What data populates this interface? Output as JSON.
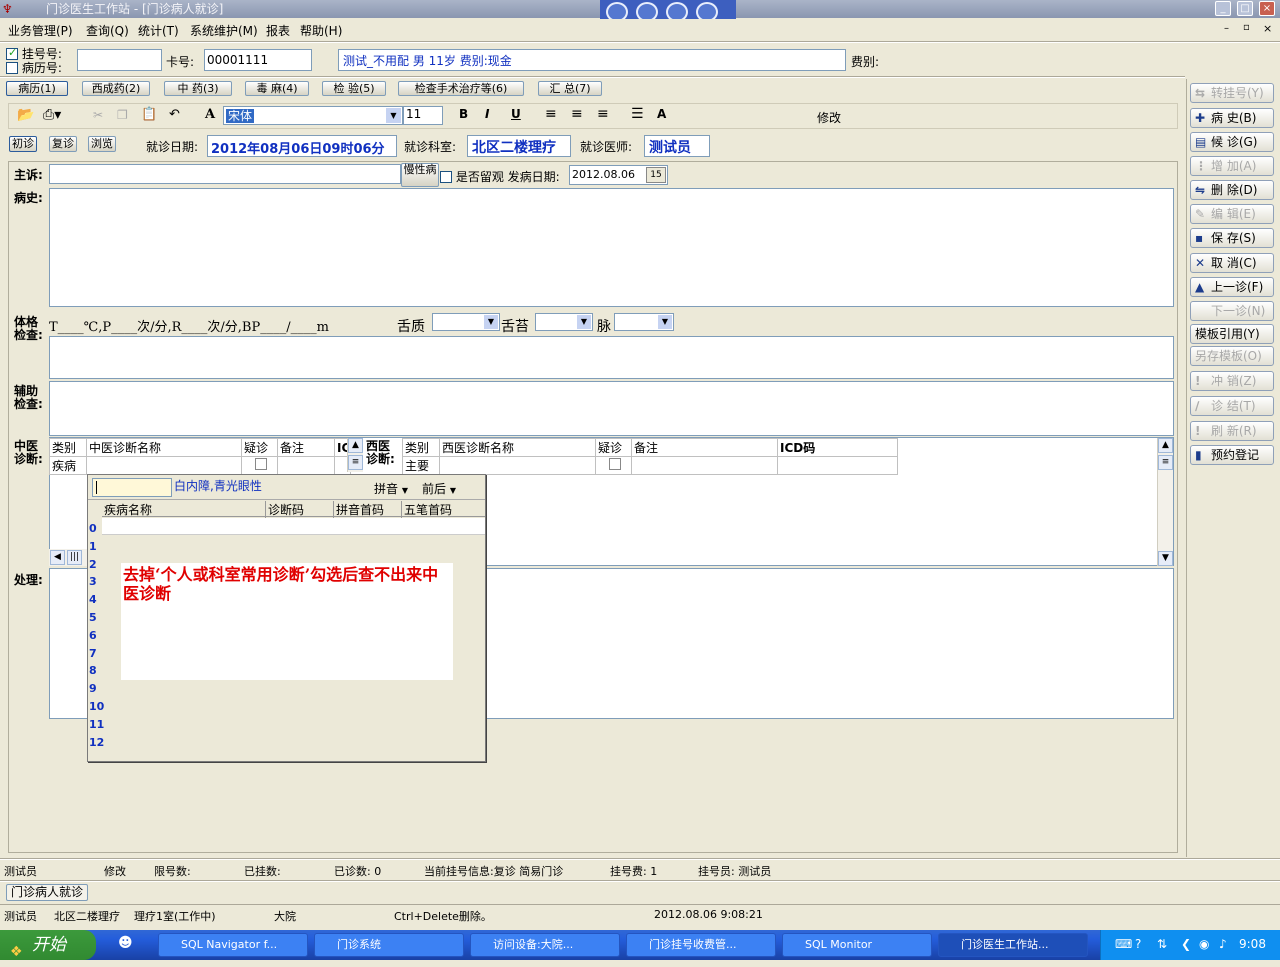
{
  "window": {
    "title": "门诊医生工作站 - [门诊病人就诊]"
  },
  "menu": [
    "业务管理(P)",
    "查询(Q)",
    "统计(T)",
    "系统维护(M)",
    "报表",
    "帮助(H)"
  ],
  "patient": {
    "reg_label": "挂号号:",
    "record_label": "病历号:",
    "card_label": "卡号:",
    "card_value": "00001111",
    "info": "测试_不用配 男 11岁 费别:现金",
    "fee_label": "费别:"
  },
  "tabs": [
    "病历(1)",
    "西成药(2)",
    "中 药(3)",
    "毒 麻(4)",
    "检 验(5)",
    "检查手术治疗等(6)",
    "汇 总(7)"
  ],
  "toolbar": {
    "font": "宋体",
    "size": "11",
    "bold": "B",
    "italic": "I",
    "underline": "U",
    "edit_label": "修改"
  },
  "visit": {
    "first": "初诊",
    "repeat": "复诊",
    "browse": "浏览",
    "date_label": "就诊日期:",
    "date": "2012年08月06日09时06分",
    "dept_label": "就诊科室:",
    "dept": "北区二楼理疗",
    "doctor_label": "就诊医师:",
    "doctor": "测试员"
  },
  "form": {
    "complaint_label": "主诉:",
    "chronic_label": "慢性病",
    "observe_label": "是否留观",
    "onset_label": "发病日期:",
    "onset_value": "2012.08.06",
    "history_label": "病史:",
    "exam_label": "体格检查:",
    "vitals": "T____℃,P____次/分,R____次/分,BP____/____m",
    "tongue_label": "舌质",
    "coating_label": "舌苔",
    "pulse_label": "脉",
    "aux_label": "辅助检查:",
    "tcm_label": "中医诊断:",
    "wm_label": "西医诊断:",
    "treat_label": "处理:"
  },
  "tcm_grid": {
    "headers": [
      "类别",
      "中医诊断名称",
      "疑诊",
      "备注",
      "IC"
    ],
    "row_type": "疾病"
  },
  "wm_grid": {
    "headers": [
      "类别",
      "西医诊断名称",
      "疑诊",
      "备注",
      "ICD码"
    ],
    "row_type": "主要"
  },
  "popup": {
    "hint": "白内障,青光眼性",
    "mode": "拼音",
    "order": "前后",
    "headers": [
      "疾病名称",
      "诊断码",
      "拼音首码",
      "五笔首码"
    ],
    "row_numbers": [
      "0",
      "1",
      "2",
      "3",
      "4",
      "5",
      "6",
      "7",
      "8",
      "9",
      "10",
      "11",
      "12"
    ],
    "note": "去掉‘个人或科室常用诊断’勾选后查不出来中医诊断"
  },
  "right_buttons": [
    {
      "label": "转挂号(Y)",
      "enabled": false,
      "icon": "transfer-icon"
    },
    {
      "label": "病 史(B)",
      "enabled": true,
      "icon": "plus-icon"
    },
    {
      "label": "候 诊(G)",
      "enabled": true,
      "icon": "page-icon"
    },
    {
      "label": "增 加(A)",
      "enabled": false,
      "icon": "add-icon"
    },
    {
      "label": "删 除(D)",
      "enabled": true,
      "icon": "delete-icon"
    },
    {
      "label": "编 辑(E)",
      "enabled": false,
      "icon": "edit-icon"
    },
    {
      "label": "保 存(S)",
      "enabled": true,
      "icon": "save-icon"
    },
    {
      "label": "取 消(C)",
      "enabled": true,
      "icon": "cancel-icon"
    },
    {
      "label": "上一诊(F)",
      "enabled": true,
      "icon": "up-icon"
    },
    {
      "label": "下一诊(N)",
      "enabled": false,
      "icon": "down-icon"
    },
    {
      "label": "模板引用(Y)",
      "enabled": true,
      "icon": ""
    },
    {
      "label": "另存模板(O)",
      "enabled": false,
      "icon": ""
    },
    {
      "label": "冲 销(Z)",
      "enabled": false,
      "icon": "exclaim-icon"
    },
    {
      "label": "诊 结(T)",
      "enabled": false,
      "icon": "check-icon"
    },
    {
      "label": "刷 新(R)",
      "enabled": false,
      "icon": "exclaim-icon"
    },
    {
      "label": "预约登记",
      "enabled": true,
      "icon": "book-icon"
    }
  ],
  "status1": {
    "user": "测试员",
    "mode": "修改",
    "limit_label": "限号数:",
    "registered_label": "已挂数:",
    "visited_label": "已诊数: 0",
    "current_info": "当前挂号信息:复诊 简易门诊",
    "fee": "挂号费: 1",
    "registrar": "挂号员: 测试员"
  },
  "mdi_tab": "门诊病人就诊",
  "status2": {
    "user": "测试员",
    "dept": "北区二楼理疗",
    "room": "理疗1室(工作中)",
    "campus": "大院",
    "hint": "Ctrl+Delete删除。",
    "datetime": "2012.08.06 9:08:21"
  },
  "taskbar": {
    "start": "开始",
    "items": [
      "SQL Navigator f...",
      "门诊系统",
      "访问设备:大院...",
      "门诊挂号收费管...",
      "SQL Monitor",
      "门诊医生工作站..."
    ],
    "clock": "9:08"
  }
}
